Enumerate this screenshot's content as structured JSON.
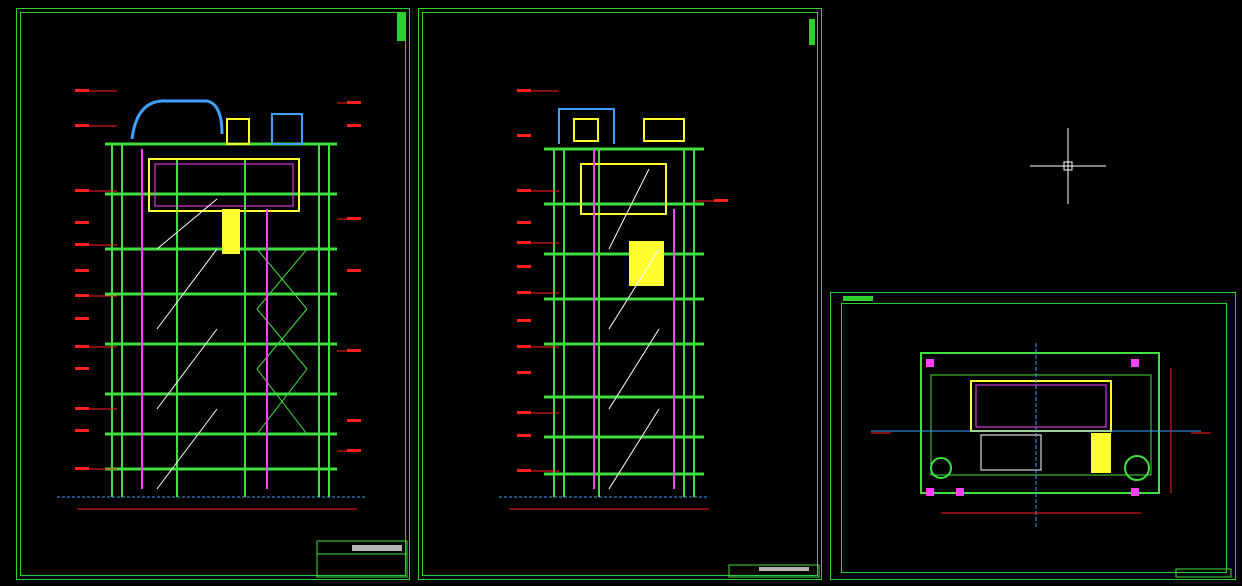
{
  "colors": {
    "background": "#000000",
    "frame": "#2fd12f",
    "structure": "#3fe03f",
    "dimension": "#ff2020",
    "ducts": "#ff40ff",
    "pipes": "#3fa0ff",
    "equipment": "#ffff30",
    "white": "#ffffff",
    "cyan": "#20e0e0"
  },
  "drawing": {
    "sheets": [
      {
        "id": "sheet-1",
        "label": "elevation-a"
      },
      {
        "id": "sheet-2",
        "label": "elevation-b"
      },
      {
        "id": "sheet-3",
        "label": "plan-view"
      }
    ],
    "cursor": {
      "icon": "crosshair-icon"
    }
  }
}
